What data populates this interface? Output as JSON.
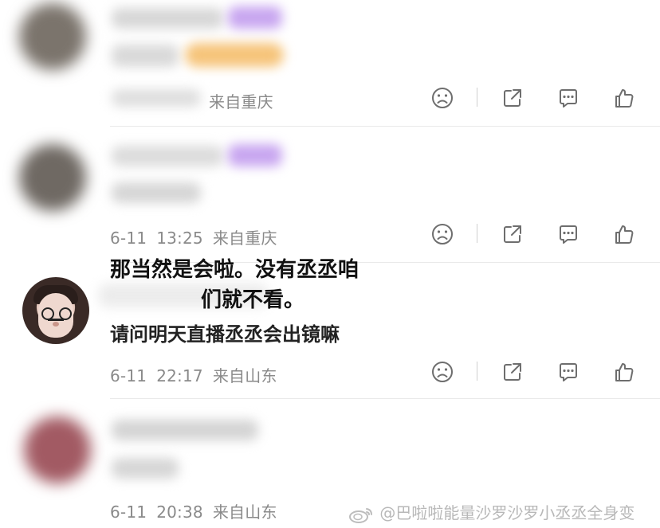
{
  "comments": [
    {
      "meta": {
        "date": "",
        "time": "",
        "location": "来自重庆"
      },
      "text": ""
    },
    {
      "meta": {
        "date": "6-11",
        "time": "13:25",
        "location": "来自重庆"
      },
      "text": ""
    },
    {
      "meta": {
        "date": "6-11",
        "time": "22:17",
        "location": "来自山东"
      },
      "text": "请问明天直播丞丞会出镜嘛"
    },
    {
      "meta": {
        "date": "6-11",
        "time": "20:38",
        "location": "来自山东"
      },
      "text": ""
    }
  ],
  "overlay": {
    "line1": "那当然是会啦。没有丞丞咱",
    "line2": "们就不看。"
  },
  "watermark": {
    "text": "@巴啦啦能量沙罗沙罗小丞丞全身变"
  },
  "icons": {
    "sad": "sad-face-icon",
    "share": "share-icon",
    "comment": "comment-icon",
    "like": "thumbs-up-icon"
  },
  "colors": {
    "meta": "#8a8a8a",
    "icon": "#6e6e6e",
    "blur_purple": "#c8a6f0",
    "blur_orange": "#f6c47a"
  }
}
